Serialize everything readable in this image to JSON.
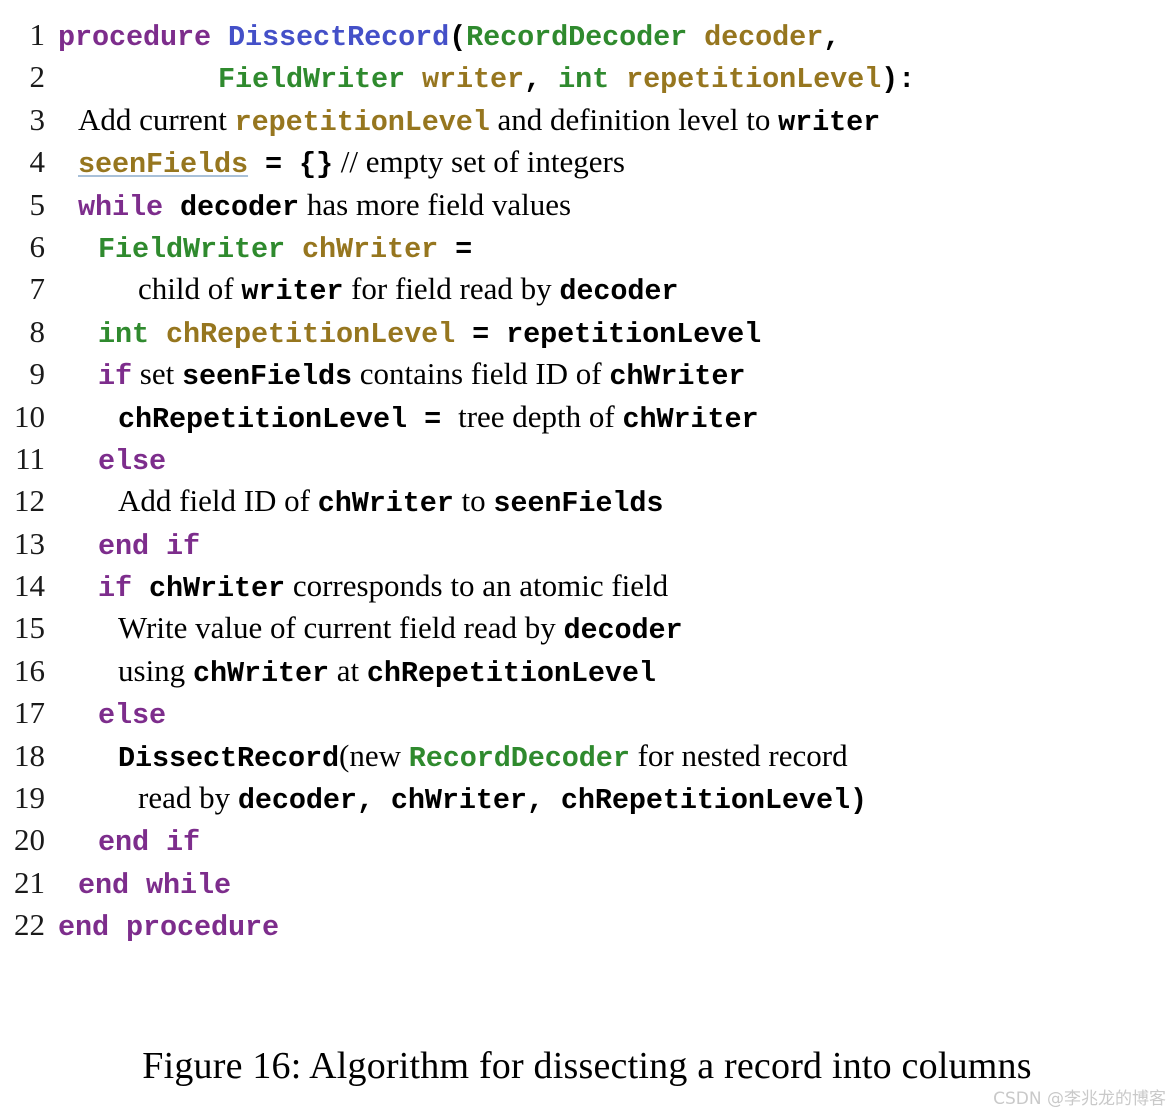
{
  "figure": {
    "caption": "Figure 16: Algorithm for dissecting a record into columns",
    "watermark": "CSDN @李兆龙的博客"
  },
  "colors": {
    "keyword": "#7d2d8c",
    "function_name": "#4450c8",
    "type_name": "#2f8a2e",
    "variable_name": "#96761f",
    "plain_text": "#000000",
    "line_number": "#1a1a1a",
    "background": "#ffffff",
    "underline": "#a8c0d8",
    "watermark": "#c9c9c9"
  },
  "listing": {
    "language": "pseudocode",
    "line_numbers": [
      "1",
      "2",
      "3",
      "4",
      "5",
      "6",
      "7",
      "8",
      "9",
      "10",
      "11",
      "12",
      "13",
      "14",
      "15",
      "16",
      "17",
      "18",
      "19",
      "20",
      "21",
      "22"
    ],
    "lines": [
      {
        "n": "1",
        "indent": 0,
        "tokens": [
          {
            "t": "procedure",
            "k": "kw"
          },
          {
            "t": " ",
            "k": "plain"
          },
          {
            "t": "DissectRecord",
            "k": "fn"
          },
          {
            "t": "(",
            "k": "plain"
          },
          {
            "t": "RecordDecoder",
            "k": "type"
          },
          {
            "t": " ",
            "k": "plain"
          },
          {
            "t": "decoder",
            "k": "var"
          },
          {
            "t": ",",
            "k": "plain"
          }
        ]
      },
      {
        "n": "2",
        "indent": 8,
        "tokens": [
          {
            "t": "FieldWriter",
            "k": "type"
          },
          {
            "t": " ",
            "k": "plain"
          },
          {
            "t": "writer",
            "k": "var"
          },
          {
            "t": ", ",
            "k": "plain"
          },
          {
            "t": "int",
            "k": "type"
          },
          {
            "t": " ",
            "k": "plain"
          },
          {
            "t": "repetitionLevel",
            "k": "var"
          },
          {
            "t": "):",
            "k": "plain"
          }
        ]
      },
      {
        "n": "3",
        "indent": 1,
        "tokens": [
          {
            "t": "Add current ",
            "k": "prose"
          },
          {
            "t": "repetitionLevel",
            "k": "var"
          },
          {
            "t": " and definition level to ",
            "k": "prose"
          },
          {
            "t": "writer",
            "k": "plain"
          }
        ]
      },
      {
        "n": "4",
        "indent": 1,
        "tokens": [
          {
            "t": "seenFields",
            "k": "var-ul"
          },
          {
            "t": " = {}",
            "k": "plain"
          },
          {
            "t": " // empty set of integers",
            "k": "prose"
          }
        ]
      },
      {
        "n": "5",
        "indent": 1,
        "tokens": [
          {
            "t": "while",
            "k": "kw"
          },
          {
            "t": " ",
            "k": "plain"
          },
          {
            "t": "decoder",
            "k": "plain"
          },
          {
            "t": " has more field values",
            "k": "prose"
          }
        ]
      },
      {
        "n": "6",
        "indent": 2,
        "tokens": [
          {
            "t": "FieldWriter",
            "k": "type"
          },
          {
            "t": " ",
            "k": "plain"
          },
          {
            "t": "chWriter",
            "k": "var"
          },
          {
            "t": " =",
            "k": "plain"
          }
        ]
      },
      {
        "n": "7",
        "indent": 4,
        "tokens": [
          {
            "t": "child of ",
            "k": "prose"
          },
          {
            "t": "writer",
            "k": "plain"
          },
          {
            "t": " for field read by ",
            "k": "prose"
          },
          {
            "t": "decoder",
            "k": "plain"
          }
        ]
      },
      {
        "n": "8",
        "indent": 2,
        "tokens": [
          {
            "t": "int",
            "k": "type"
          },
          {
            "t": " ",
            "k": "plain"
          },
          {
            "t": "chRepetitionLevel",
            "k": "var"
          },
          {
            "t": " = ",
            "k": "plain"
          },
          {
            "t": "repetitionLevel",
            "k": "plain"
          }
        ]
      },
      {
        "n": "9",
        "indent": 2,
        "tokens": [
          {
            "t": "if",
            "k": "kw"
          },
          {
            "t": " set ",
            "k": "prose"
          },
          {
            "t": "seenFields",
            "k": "plain"
          },
          {
            "t": " contains field ID of ",
            "k": "prose"
          },
          {
            "t": "chWriter",
            "k": "plain"
          }
        ]
      },
      {
        "n": "10",
        "indent": 3,
        "tokens": [
          {
            "t": "chRepetitionLevel",
            "k": "plain"
          },
          {
            "t": " = ",
            "k": "plain"
          },
          {
            "t": "tree depth of ",
            "k": "prose"
          },
          {
            "t": "chWriter",
            "k": "plain"
          }
        ]
      },
      {
        "n": "11",
        "indent": 2,
        "tokens": [
          {
            "t": "else",
            "k": "kw"
          }
        ]
      },
      {
        "n": "12",
        "indent": 3,
        "tokens": [
          {
            "t": "Add field ID of ",
            "k": "prose"
          },
          {
            "t": "chWriter",
            "k": "plain"
          },
          {
            "t": " to ",
            "k": "prose"
          },
          {
            "t": "seenFields",
            "k": "plain"
          }
        ]
      },
      {
        "n": "13",
        "indent": 2,
        "tokens": [
          {
            "t": "end if",
            "k": "kw"
          }
        ]
      },
      {
        "n": "14",
        "indent": 2,
        "tokens": [
          {
            "t": "if",
            "k": "kw"
          },
          {
            "t": " ",
            "k": "plain"
          },
          {
            "t": "chWriter",
            "k": "plain"
          },
          {
            "t": " corresponds to an atomic field",
            "k": "prose"
          }
        ]
      },
      {
        "n": "15",
        "indent": 3,
        "tokens": [
          {
            "t": "Write value of current field read by ",
            "k": "prose"
          },
          {
            "t": "decoder",
            "k": "plain"
          }
        ]
      },
      {
        "n": "16",
        "indent": 3,
        "tokens": [
          {
            "t": "using ",
            "k": "prose"
          },
          {
            "t": "chWriter",
            "k": "plain"
          },
          {
            "t": " at ",
            "k": "prose"
          },
          {
            "t": "chRepetitionLevel",
            "k": "plain"
          }
        ]
      },
      {
        "n": "17",
        "indent": 2,
        "tokens": [
          {
            "t": "else",
            "k": "kw"
          }
        ]
      },
      {
        "n": "18",
        "indent": 3,
        "tokens": [
          {
            "t": "DissectRecord",
            "k": "plain"
          },
          {
            "t": "(",
            "k": "prose"
          },
          {
            "t": "new ",
            "k": "prose"
          },
          {
            "t": "RecordDecoder",
            "k": "type"
          },
          {
            "t": " for nested record",
            "k": "prose"
          }
        ]
      },
      {
        "n": "19",
        "indent": 4,
        "tokens": [
          {
            "t": "read by ",
            "k": "prose"
          },
          {
            "t": "decoder, chWriter, chRepetitionLevel)",
            "k": "plain"
          }
        ]
      },
      {
        "n": "20",
        "indent": 2,
        "tokens": [
          {
            "t": "end if",
            "k": "kw"
          }
        ]
      },
      {
        "n": "21",
        "indent": 1,
        "tokens": [
          {
            "t": "end while",
            "k": "kw"
          }
        ]
      },
      {
        "n": "22",
        "indent": 0,
        "tokens": [
          {
            "t": "end procedure",
            "k": "kw"
          }
        ]
      }
    ]
  }
}
